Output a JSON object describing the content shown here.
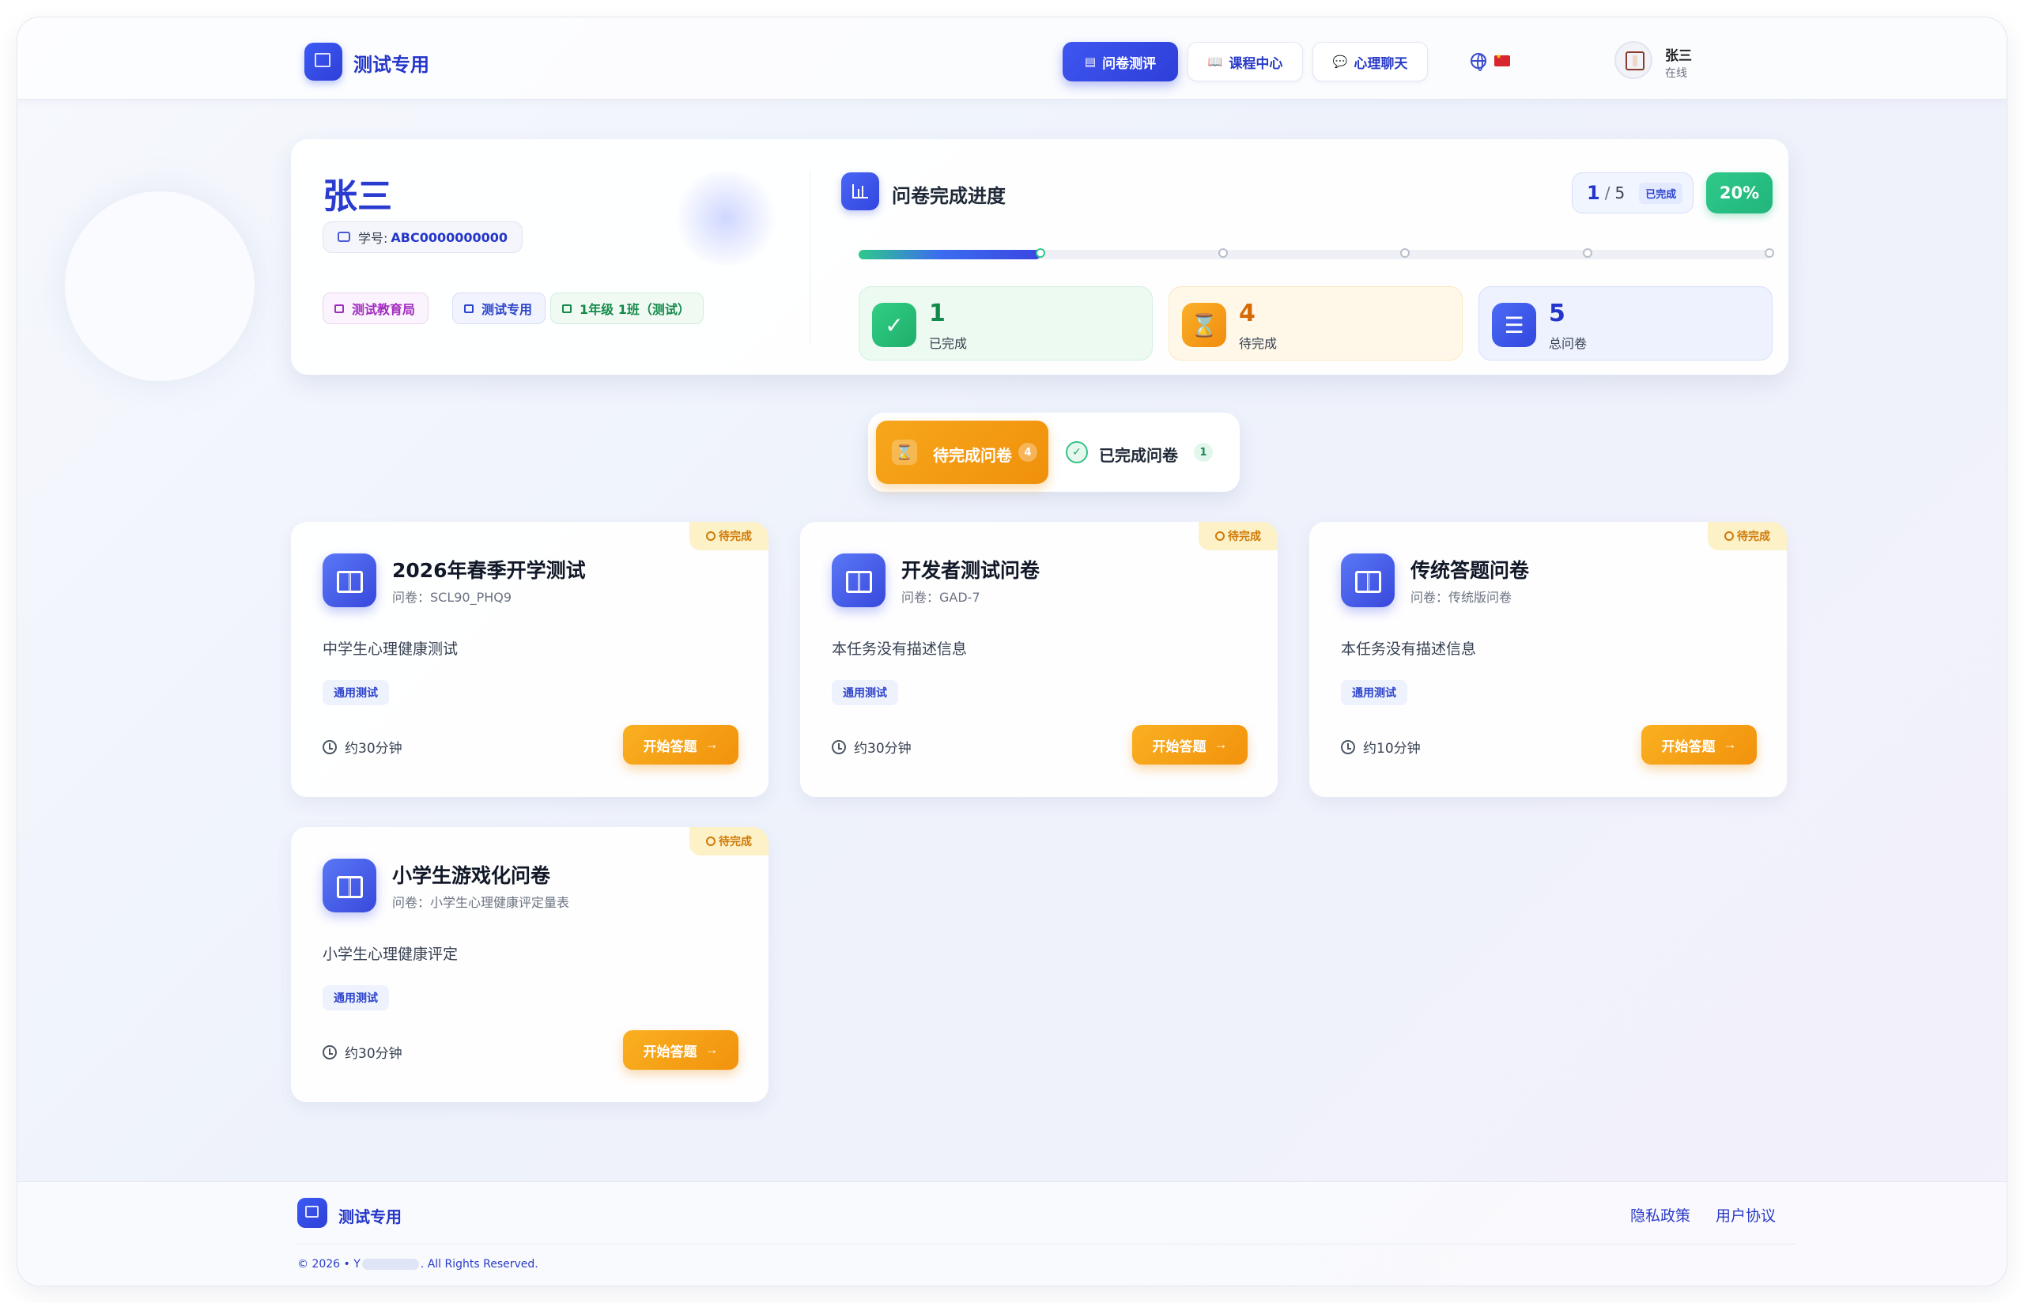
{
  "header": {
    "brand": "测试专用",
    "nav": [
      {
        "label": "问卷测评",
        "icon": "clipboard-icon",
        "active": true
      },
      {
        "label": "课程中心",
        "icon": "book-open-icon",
        "active": false
      },
      {
        "label": "心理聊天",
        "icon": "chat-bubbles-icon",
        "active": false
      }
    ],
    "user": {
      "name": "张三",
      "status": "在线"
    }
  },
  "profile": {
    "name": "张三",
    "student_id_label": "学号:",
    "student_id": "ABC0000000000",
    "tags": [
      "测试教育局",
      "测试专用",
      "1年级 1班（测试）"
    ]
  },
  "progress": {
    "title": "问卷完成进度",
    "completed": "1",
    "separator": "/",
    "total": "5",
    "completed_label": "已完成",
    "percent_text": "20%",
    "fraction": 0.2,
    "stats": [
      {
        "value": "1",
        "label": "已完成"
      },
      {
        "value": "4",
        "label": "待完成"
      },
      {
        "value": "5",
        "label": "总问卷"
      }
    ]
  },
  "tabs": {
    "pending_label": "待完成问卷",
    "pending_count": "4",
    "done_label": "已完成问卷",
    "done_count": "1"
  },
  "cards": [
    {
      "status": "待完成",
      "title": "2026年春季开学测试",
      "subtitle": "问卷：SCL90_PHQ9",
      "desc": "中学生心理健康测试",
      "tag": "通用测试",
      "time": "约30分钟",
      "button": "开始答题"
    },
    {
      "status": "待完成",
      "title": "开发者测试问卷",
      "subtitle": "问卷：GAD-7",
      "desc": "本任务没有描述信息",
      "tag": "通用测试",
      "time": "约30分钟",
      "button": "开始答题"
    },
    {
      "status": "待完成",
      "title": "传统答题问卷",
      "subtitle": "问卷：传统版问卷",
      "desc": "本任务没有描述信息",
      "tag": "通用测试",
      "time": "约10分钟",
      "button": "开始答题"
    },
    {
      "status": "待完成",
      "title": "小学生游戏化问卷",
      "subtitle": "问卷：小学生心理健康评定量表",
      "desc": "小学生心理健康评定",
      "tag": "通用测试",
      "time": "约30分钟",
      "button": "开始答题"
    }
  ],
  "footer": {
    "brand": "测试专用",
    "links": [
      "隐私政策",
      "用户协议"
    ],
    "copyright_prefix": "© 2026 • Y",
    "copyright_suffix": ". All Rights Reserved."
  },
  "colors": {
    "primary": "#2f3fd6",
    "success": "#2fc98a",
    "warning": "#f2920c"
  }
}
